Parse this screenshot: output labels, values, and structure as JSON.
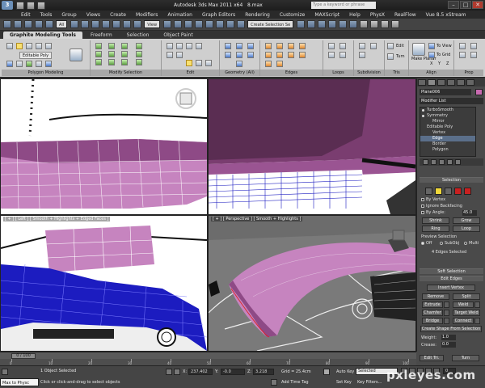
{
  "window": {
    "title": "Autodesk 3ds Max 2011 x64",
    "file": "8.max",
    "search_placeholder": "Type a keyword or phrase",
    "buttons": [
      "–",
      "□",
      "✕"
    ]
  },
  "menu": [
    "Edit",
    "Tools",
    "Group",
    "Views",
    "Create",
    "Modifiers",
    "Animation",
    "Graph Editors",
    "Rendering",
    "Customize",
    "MAXScript",
    "Help",
    "PhysX",
    "RealFlow",
    "Vue 8.5 xStream"
  ],
  "toolbar": {
    "selection_filter": "All",
    "view_dropdown": "View",
    "named_selection": "Create Selection Se"
  },
  "ribbon": {
    "tabs": [
      "Graphite Modeling Tools",
      "Freeform",
      "Selection",
      "Object Paint"
    ],
    "active_tab": "Graphite Modeling Tools",
    "panels": [
      "Polygon Modeling",
      "Modify Selection",
      "Edit",
      "Geometry (All)",
      "Edges",
      "Loops",
      "Subdivision",
      "Tris",
      "Align",
      "Prop"
    ],
    "editable_poly_label": "Editable Poly",
    "edit_label": "Edit",
    "turn_label": "Turn",
    "make_planar_label": "Make\nPlanar",
    "to_view_label": "To View",
    "to_grid_label": "To Grid",
    "xyz": [
      "X",
      "Y",
      "Z"
    ]
  },
  "viewports": {
    "left_label": "[ + ] [ Left ] [ Smooth + Highlights + Edged Faces ]",
    "perspective_label": "[ + ] [ Perspective ] [ Smooth + Highlights ]"
  },
  "command_panel": {
    "object_name": "Plane006",
    "modifier_list": "Modifier List",
    "stack": [
      {
        "label": "TurboSmooth",
        "level": 0,
        "selected": false
      },
      {
        "label": "Symmetry",
        "level": 0,
        "selected": false
      },
      {
        "label": "Mirror",
        "level": 1,
        "selected": false
      },
      {
        "label": "Editable Poly",
        "level": 0,
        "selected": false
      },
      {
        "label": "Vertex",
        "level": 1,
        "selected": false
      },
      {
        "label": "Edge",
        "level": 1,
        "selected": true
      },
      {
        "label": "Border",
        "level": 1,
        "selected": false
      },
      {
        "label": "Polygon",
        "level": 1,
        "selected": false
      }
    ],
    "selection_rollout": "Selection",
    "by_vertex": "By Vertex",
    "ignore_backfacing": "Ignore Backfacing",
    "by_angle": "By Angle:",
    "by_angle_value": "45.0",
    "shrink": "Shrink",
    "grow": "Grow",
    "ring": "Ring",
    "loop": "Loop",
    "preview_selection": "Preview Selection",
    "preview_off": "Off",
    "preview_subobj": "SubObj",
    "preview_multi": "Multi",
    "edges_selected": "4 Edges Selected",
    "soft_selection": "Soft Selection",
    "edit_edges": "Edit Edges",
    "insert_vertex": "Insert Vertex",
    "remove": "Remove",
    "split": "Split",
    "extrude": "Extrude",
    "weld": "Weld",
    "chamfer": "Chamfer",
    "target_weld": "Target Weld",
    "bridge": "Bridge",
    "connect": "Connect",
    "create_shape": "Create Shape From Selection",
    "weight_label": "Weight:",
    "weight_value": "1.0",
    "crease_label": "Crease:",
    "crease_value": "0.0",
    "edit_tri": "Edit Tri.",
    "turn": "Turn"
  },
  "timeline": {
    "slider": "0 / 100",
    "ticks": [
      "0",
      "10",
      "20",
      "30",
      "40",
      "50",
      "60",
      "70",
      "80",
      "90",
      "100"
    ]
  },
  "status": {
    "maxscript": "Max to Physc",
    "object_selected": "1 Object Selected",
    "prompt": "Click or click-and-drag to select objects",
    "x_label": "X:",
    "x_value": "237.402",
    "y_label": "Y:",
    "y_value": "-0.0",
    "z_label": "Z:",
    "z_value": "3.218",
    "grid": "Grid = 25.4cm",
    "add_time_tag": "Add Time Tag",
    "auto_key": "Auto Key",
    "auto_key_value": "Selected",
    "set_key": "Set Key",
    "key_filters": "Key Filters...",
    "frame": "0"
  },
  "watermark": "pxleyes.com",
  "colors": {
    "mesh_pink": "#c884c0",
    "wire_blue": "#1c1cc0",
    "accent_yellow": "#f0d83a"
  }
}
